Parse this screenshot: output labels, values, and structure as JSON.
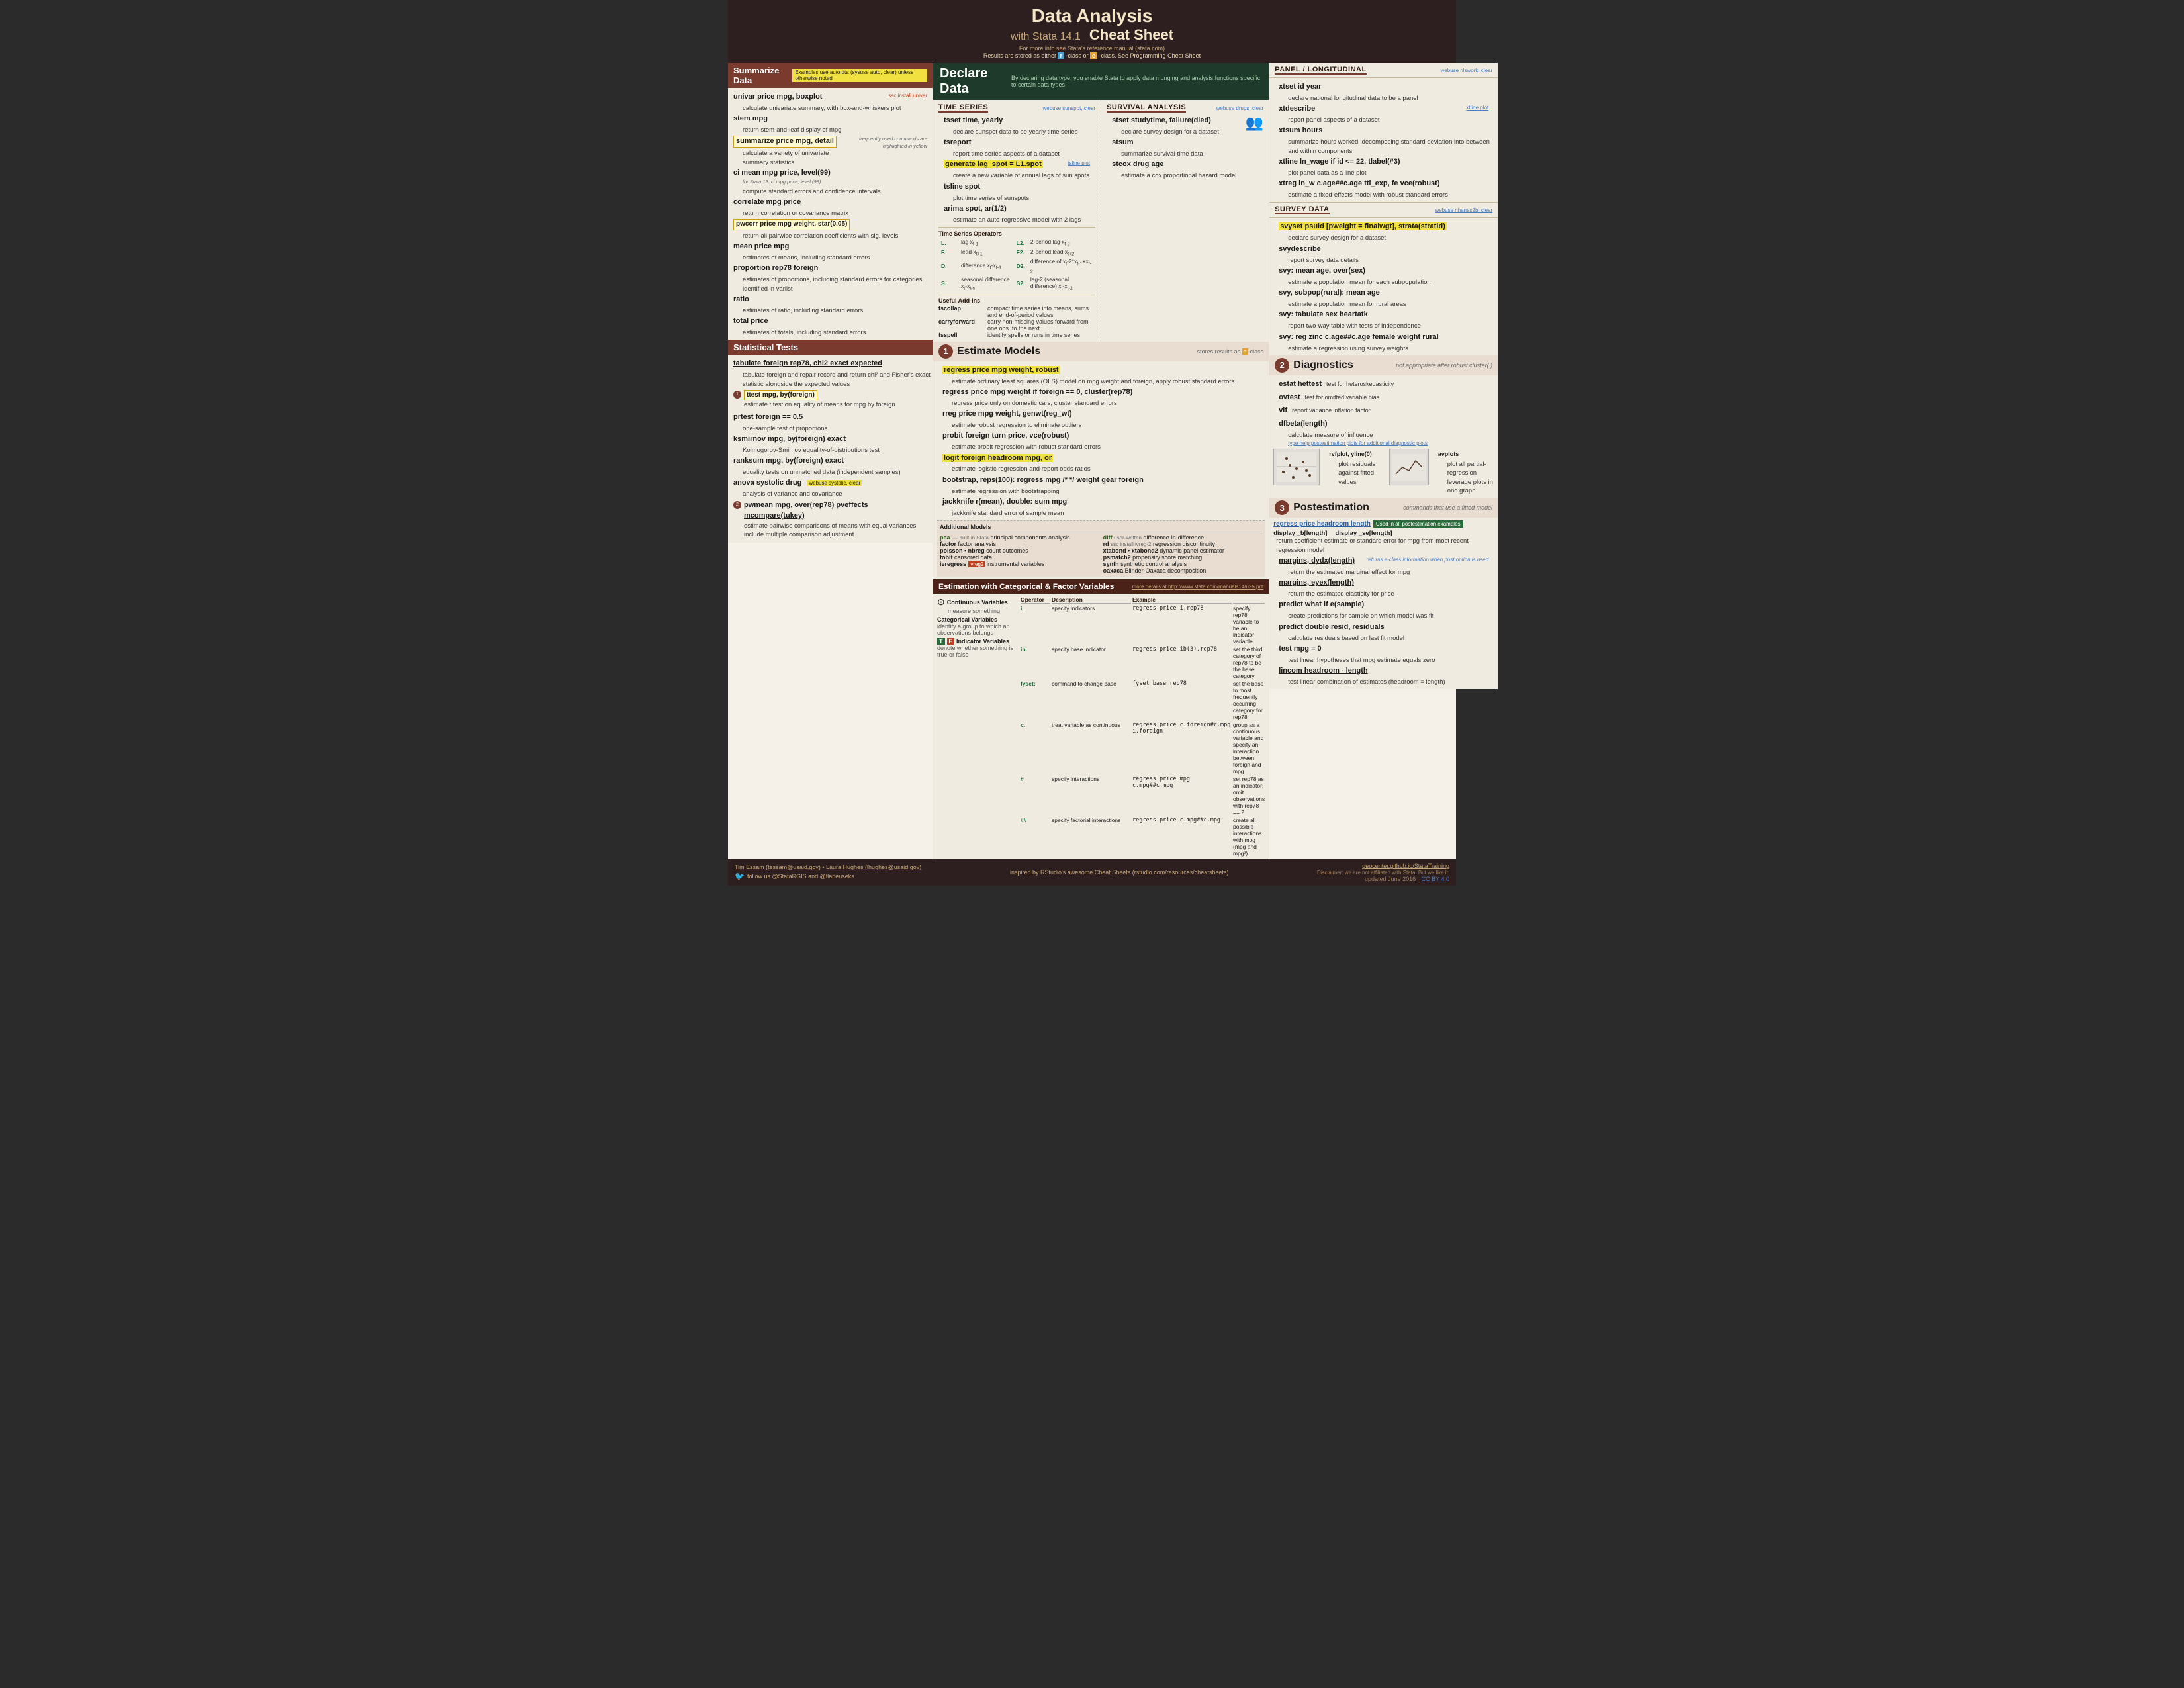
{
  "header": {
    "title": "Data Analysis",
    "subtitle": "with Stata 14.1",
    "cheatsheet": "Cheat Sheet",
    "info": "For more info see Stata's reference manual (stata.com)",
    "results_note": "Results are stored as either",
    "r_class": "r",
    "e_class": "e",
    "class_note": "-class or",
    "class_note2": "-class. See Programming Cheat Sheet",
    "highlight_note": "Examples use auto.dta (sysuse auto, clear) unless otherwise noted",
    "highlight_label": "frequently used commands are highlighted in yellow"
  },
  "summarize": {
    "title": "Summarize Data",
    "univar": "univar price mpg, boxplot",
    "univar_desc": "calculate univariate summary, with box-and-whiskers plot",
    "univar_note": "ssc install univar",
    "stem": "stem mpg",
    "stem_desc": "return stem-and-leaf display of mpg",
    "summarize_cmd": "summarize price mpg, detail",
    "summarize_note": "frequently used commands are highlighted in yellow",
    "summarize_desc": "calculate a variety of univariate summary statistics",
    "ci": "ci mean mpg price, level(99)",
    "ci_note": "for Stata 13: ci mpg price, level (99)",
    "ci_desc": "compute standard errors and confidence intervals",
    "correlate": "correlate mpg price",
    "correlate_desc": "return correlation or covariance matrix",
    "pwcorr": "pwcorr price mpg weight, star(0.05)",
    "pwcorr_desc": "return all pairwise correlation coefficients with sig. levels",
    "mean": "mean price mpg",
    "mean_desc": "estimates of means, including standard errors",
    "proportion": "proportion rep78 foreign",
    "proportion_desc": "estimates of proportions, including standard errors for categories identified in varlist",
    "ratio": "ratio",
    "ratio_desc": "estimates of ratio, including standard errors",
    "total": "total price",
    "total_desc": "estimates of totals, including standard errors"
  },
  "statistical_tests": {
    "title": "Statistical Tests",
    "tabulate": "tabulate foreign rep78, chi2 exact expected",
    "tabulate_desc": "tabulate foreign and repair record and return chi² and Fisher's exact statistic alongside the expected values",
    "ttest": "ttest mpg, by(foreign)",
    "ttest_desc": "estimate t test on equality of means for mpg by foreign",
    "prtest": "prtest foreign == 0.5",
    "prtest_desc": "one-sample test of proportions",
    "ksmirnov": "ksmirnov mpg, by(foreign) exact",
    "ksmirnov_desc": "Kolmogorov-Smirnov equality-of-distributions test",
    "ranksum": "ranksum mpg, by(foreign) exact",
    "ranksum_desc": "equality tests on unmatched data (independent samples)",
    "anova": "anova systolic drug",
    "anova_webuse": "webuse systolic, clear",
    "anova_desc": "analysis of variance and covariance",
    "pwmean": "pwmean mpg, over(rep78) pveffects mcompare(tukey)",
    "pwmean_desc": "estimate pairwise comparisons of means with equal variances include multiple comparison adjustment"
  },
  "declare_data": {
    "title": "Declare Data",
    "note": "By declaring data type, you enable Stata to apply data munging and analysis functions specific to certain data types",
    "time_series": {
      "title": "Time Series",
      "webuse": "webuse sunspot, clear",
      "tsset": "tsset time, yearly",
      "tsset_desc": "declare sunspot data to be yearly time series",
      "tsreport": "tsreport",
      "tsreport_desc": "report time series aspects of a dataset",
      "generate": "generate lag_spot = L1.spot",
      "generate_desc": "create a new variable of annual lags of sun spots",
      "generate_note": "tsline plot",
      "tsline": "tsline spot",
      "tsline_desc": "plot time series of sunspots",
      "arima": "arima spot, ar(1/2)",
      "arima_desc": "estimate an auto-regressive model with 2 lags",
      "operators_title": "Time Series Operators",
      "operators": [
        {
          "key": "L.",
          "desc": "lag x_{t-1}",
          "key2": "L2.",
          "desc2": "2-period lag x_{t-2}"
        },
        {
          "key": "F.",
          "desc": "lead x_{t+1}",
          "key2": "F2.",
          "desc2": "2-period lead x_{t+2}"
        },
        {
          "key": "D.",
          "desc": "difference x_t-x_{t-1}",
          "key2": "D2.",
          "desc2": "difference of differences x_t-2*x_{t-1}+x_{t-2}"
        },
        {
          "key": "S.",
          "desc": "seasonal difference x_t-x_{t-s}",
          "key2": "S2.",
          "desc2": "lag-2 (seasonal difference) x_t-x_{t-2}"
        }
      ],
      "useful_title": "Useful Add-Ins",
      "tscollap": "tscollap",
      "tscollap_desc": "compact time series into means, sums and end-of-period values",
      "carryforward": "carryforward",
      "carryforward_desc": "carry non-missing values forward from one obs. to the next",
      "tsspell": "tsspell",
      "tsspell_desc": "identify spells or runs in time series"
    },
    "survival": {
      "title": "Survival Analysis",
      "webuse": "webuse drugs, clear",
      "stset": "stset studytime, failure(died)",
      "stset_desc": "declare survey design for a dataset",
      "stsum": "stsum",
      "stsum_desc": "summarize survival-time data",
      "stcox": "stcox drug age",
      "stcox_desc": "estimate a cox proportional hazard model"
    }
  },
  "panel": {
    "title": "Panel / Longitudinal",
    "webuse": "webuse nlswork, clear",
    "xtset": "xtset id year",
    "xtset_desc": "declare national longitudinal data to be a panel",
    "xtdescribe": "xtdescribe",
    "xtdescribe_desc": "report panel aspects of a dataset",
    "xtsum": "xtsum hours",
    "xtsum_desc": "summarize hours worked, decomposing standard deviation into between and within components",
    "xtline_note": "xtline plot",
    "xtline": "xtline ln_wage if id <= 22, tlabel(#3)",
    "xtline_desc": "plot panel data as a line plot",
    "xtreg": "xtreg ln_w c.age##c.age ttl_exp, fe vce(robust)",
    "xtreg_desc": "estimate a fixed-effects model with robust standard errors"
  },
  "survey": {
    "title": "Survey Data",
    "webuse": "webuse nhanes2b, clear",
    "svyset": "svyset psuid [pweight = finalwgt], strata(stratid)",
    "svyset_desc": "declare survey design for a dataset",
    "svydescribe": "svydescribe",
    "svydescribe_desc": "report survey data details",
    "svy_mean": "svy: mean age, over(sex)",
    "svy_mean_desc": "estimate a population mean for each subpopulation",
    "svy_subpop": "svy, subpop(rural): mean age",
    "svy_subpop_desc": "estimate a population mean for rural areas",
    "svy_tabulate": "svy: tabulate sex heartatk",
    "svy_tabulate_desc": "report two-way table with tests of independence",
    "svy_reg": "svy: reg zinc c.age##c.age female weight rural",
    "svy_reg_desc": "estimate a regression using survey weights"
  },
  "estimate_models": {
    "title": "Estimate Models",
    "stores_note": "stores results as e-class",
    "regress": "regress price mpg weight, robust",
    "regress_desc": "estimate ordinary least squares (OLS) model on mpg weight and foreign, apply robust standard errors",
    "regress2": "regress price mpg weight if foreign == 0, cluster(rep78)",
    "regress2_desc": "regress price only on domestic cars, cluster standard errors",
    "rreg": "rreg price mpg weight, genwt(reg_wt)",
    "rreg_desc": "estimate robust regression to eliminate outliers",
    "probit": "probit foreign turn price, vce(robust)",
    "probit_desc": "estimate probit regression with robust standard errors",
    "logit": "logit foreign headroom mpg, or",
    "logit_desc": "estimate logistic regression and report odds ratios",
    "bootstrap": "bootstrap, reps(100): regress mpg /* */ weight gear foreign",
    "bootstrap_desc": "estimate regression with bootstrapping",
    "jackknife": "jackknife r(mean), double: sum mpg",
    "jackknife_desc": "jackknife standard error of sample mean",
    "additional_models": {
      "title": "Additional Models",
      "pca": "pca",
      "pca_desc": "principal components analysis",
      "factor": "factor",
      "factor_desc": "factor analysis",
      "poisson": "poisson • nbreg",
      "poisson_desc": "count outcomes",
      "tobit": "tobit",
      "tobit_desc": "censored data",
      "ivregress": "ivregress",
      "ivregress_desc": "instrumental variables",
      "diff": "diff",
      "diff_desc": "difference-in-difference",
      "rd": "rd",
      "rd_desc": "regression discontinuity",
      "xtabond": "xtabond • xtabond2",
      "xtabond_desc": "dynamic panel estimator",
      "psmatch2": "psmatch2",
      "psmatch2_desc": "propensity score matching",
      "synth": "synth",
      "synth_desc": "synthetic control analysis",
      "oaxaca": "oaxaca",
      "oaxaca_desc": "Blinder-Oaxaca decomposition"
    }
  },
  "diagnostics": {
    "title": "Diagnostics",
    "note": "not appropriate after robust cluster( )",
    "estat_hettest": "estat hettest",
    "estat_hettest_desc": "test for heteroskedasticity",
    "ovtest": "ovtest",
    "ovtest_desc": "test for omitted variable bias",
    "vif": "vif",
    "vif_desc": "report variance inflation factor",
    "dfbeta": "dfbeta(length)",
    "dfbeta_desc": "calculate measure of influence",
    "dfbeta_note": "type help postestimation plots for additional diagnostic plots",
    "rvfplot": "rvfplot, yline(0)",
    "rvfplot_desc": "plot residuals against fitted values",
    "avplots": "avplots",
    "avplots_desc": "plot all partial-regression leverage plots in one graph"
  },
  "postestimation": {
    "title": "Postestimation",
    "note": "commands that use a fitted model",
    "regress_ex": "regress price headroom length",
    "regress_ex_note": "Used in all postestimation examples",
    "display_b": "display _b[length]",
    "display_se": "display _se[length]",
    "display_desc": "return coefficient estimate or standard error for mpg from most recent regression model",
    "margins_dydx": "margins, dydx(length)",
    "margins_dydx_note": "returns e-class information when post option is used",
    "margins_dydx_desc": "return the estimated marginal effect for mpg",
    "margins_eyex": "margins, eyex(length)",
    "margins_eyex_desc": "return the estimated elasticity for price",
    "predict": "predict what if e(sample)",
    "predict_desc": "create predictions for sample on which model was fit",
    "predict2": "predict double resid, residuals",
    "predict2_desc": "calculate residuals based on last fit model",
    "test": "test mpg = 0",
    "test_desc": "test linear hypotheses that mpg estimate equals zero",
    "lincom": "lincom headroom - length",
    "lincom_desc": "test linear combination of estimates (headroom = length)"
  },
  "categorical": {
    "title": "Estimation with Categorical & Factor Variables",
    "more_details": "more details at http://www.stata.com/manuals14/u25.pdf",
    "continuous_var": "Continuous Variables",
    "continuous_desc": "measure something",
    "categorical_var": "Categorical Variables",
    "categorical_desc": "identify a group to which an observations belongs",
    "indicator_var": "Indicator Variables",
    "indicator_t": "T",
    "indicator_f": "F",
    "indicator_desc": "denote whether something is true or false",
    "operators": [
      {
        "op": "i.",
        "desc": "specify indicators",
        "example": "regress price i.rep78",
        "ex_desc": "specify rep78 variable to be an indicator variable"
      },
      {
        "op": "ib.",
        "desc": "specify base indicator",
        "example": "regress price ib(3).rep78",
        "ex_desc": "set the third category of rep78 to be the base category"
      },
      {
        "op": "fyset:",
        "desc": "command to change base",
        "example": "regress price fyset base rep78",
        "ex_desc": "set the base to most frequently occurring category for rep78"
      },
      {
        "op": "c.",
        "desc": "treat variable as continuous",
        "example": "regress price c.foreign#c.mpg i.foreign",
        "ex_desc": "group as a continuous variable and specify an interaction between foreign and mpg"
      },
      {
        "op": "#",
        "desc": "specify interactions",
        "example": "regress price mpg c.mpg##c.mpg",
        "ex_desc": "set rep78 as an indicator; omit observations with rep78 == 2"
      },
      {
        "op": "##",
        "desc": "specify factorial interactions",
        "example": "regress price c.mpg##c.mpg",
        "ex_desc": "create all possible interactions with mpg (mpg and mpg²)"
      }
    ]
  },
  "footer": {
    "author1": "Tim Essam (tessam@usaid.gov)",
    "author2": "Laura Hughes (lhughes@usaid.gov)",
    "inspired": "inspired by RStudio's awesome Cheat Sheets (rstudio.com/resources/cheatsheets)",
    "geocenter": "geocenter.github.io/StataTraining",
    "disclaimer": "Disclaimer: we are not affiliated with Stata. But we like it.",
    "twitter": "follow us @StataRGIS and @flaneuseks",
    "updated": "updated June 2016",
    "license": "CC BY 4.0"
  }
}
